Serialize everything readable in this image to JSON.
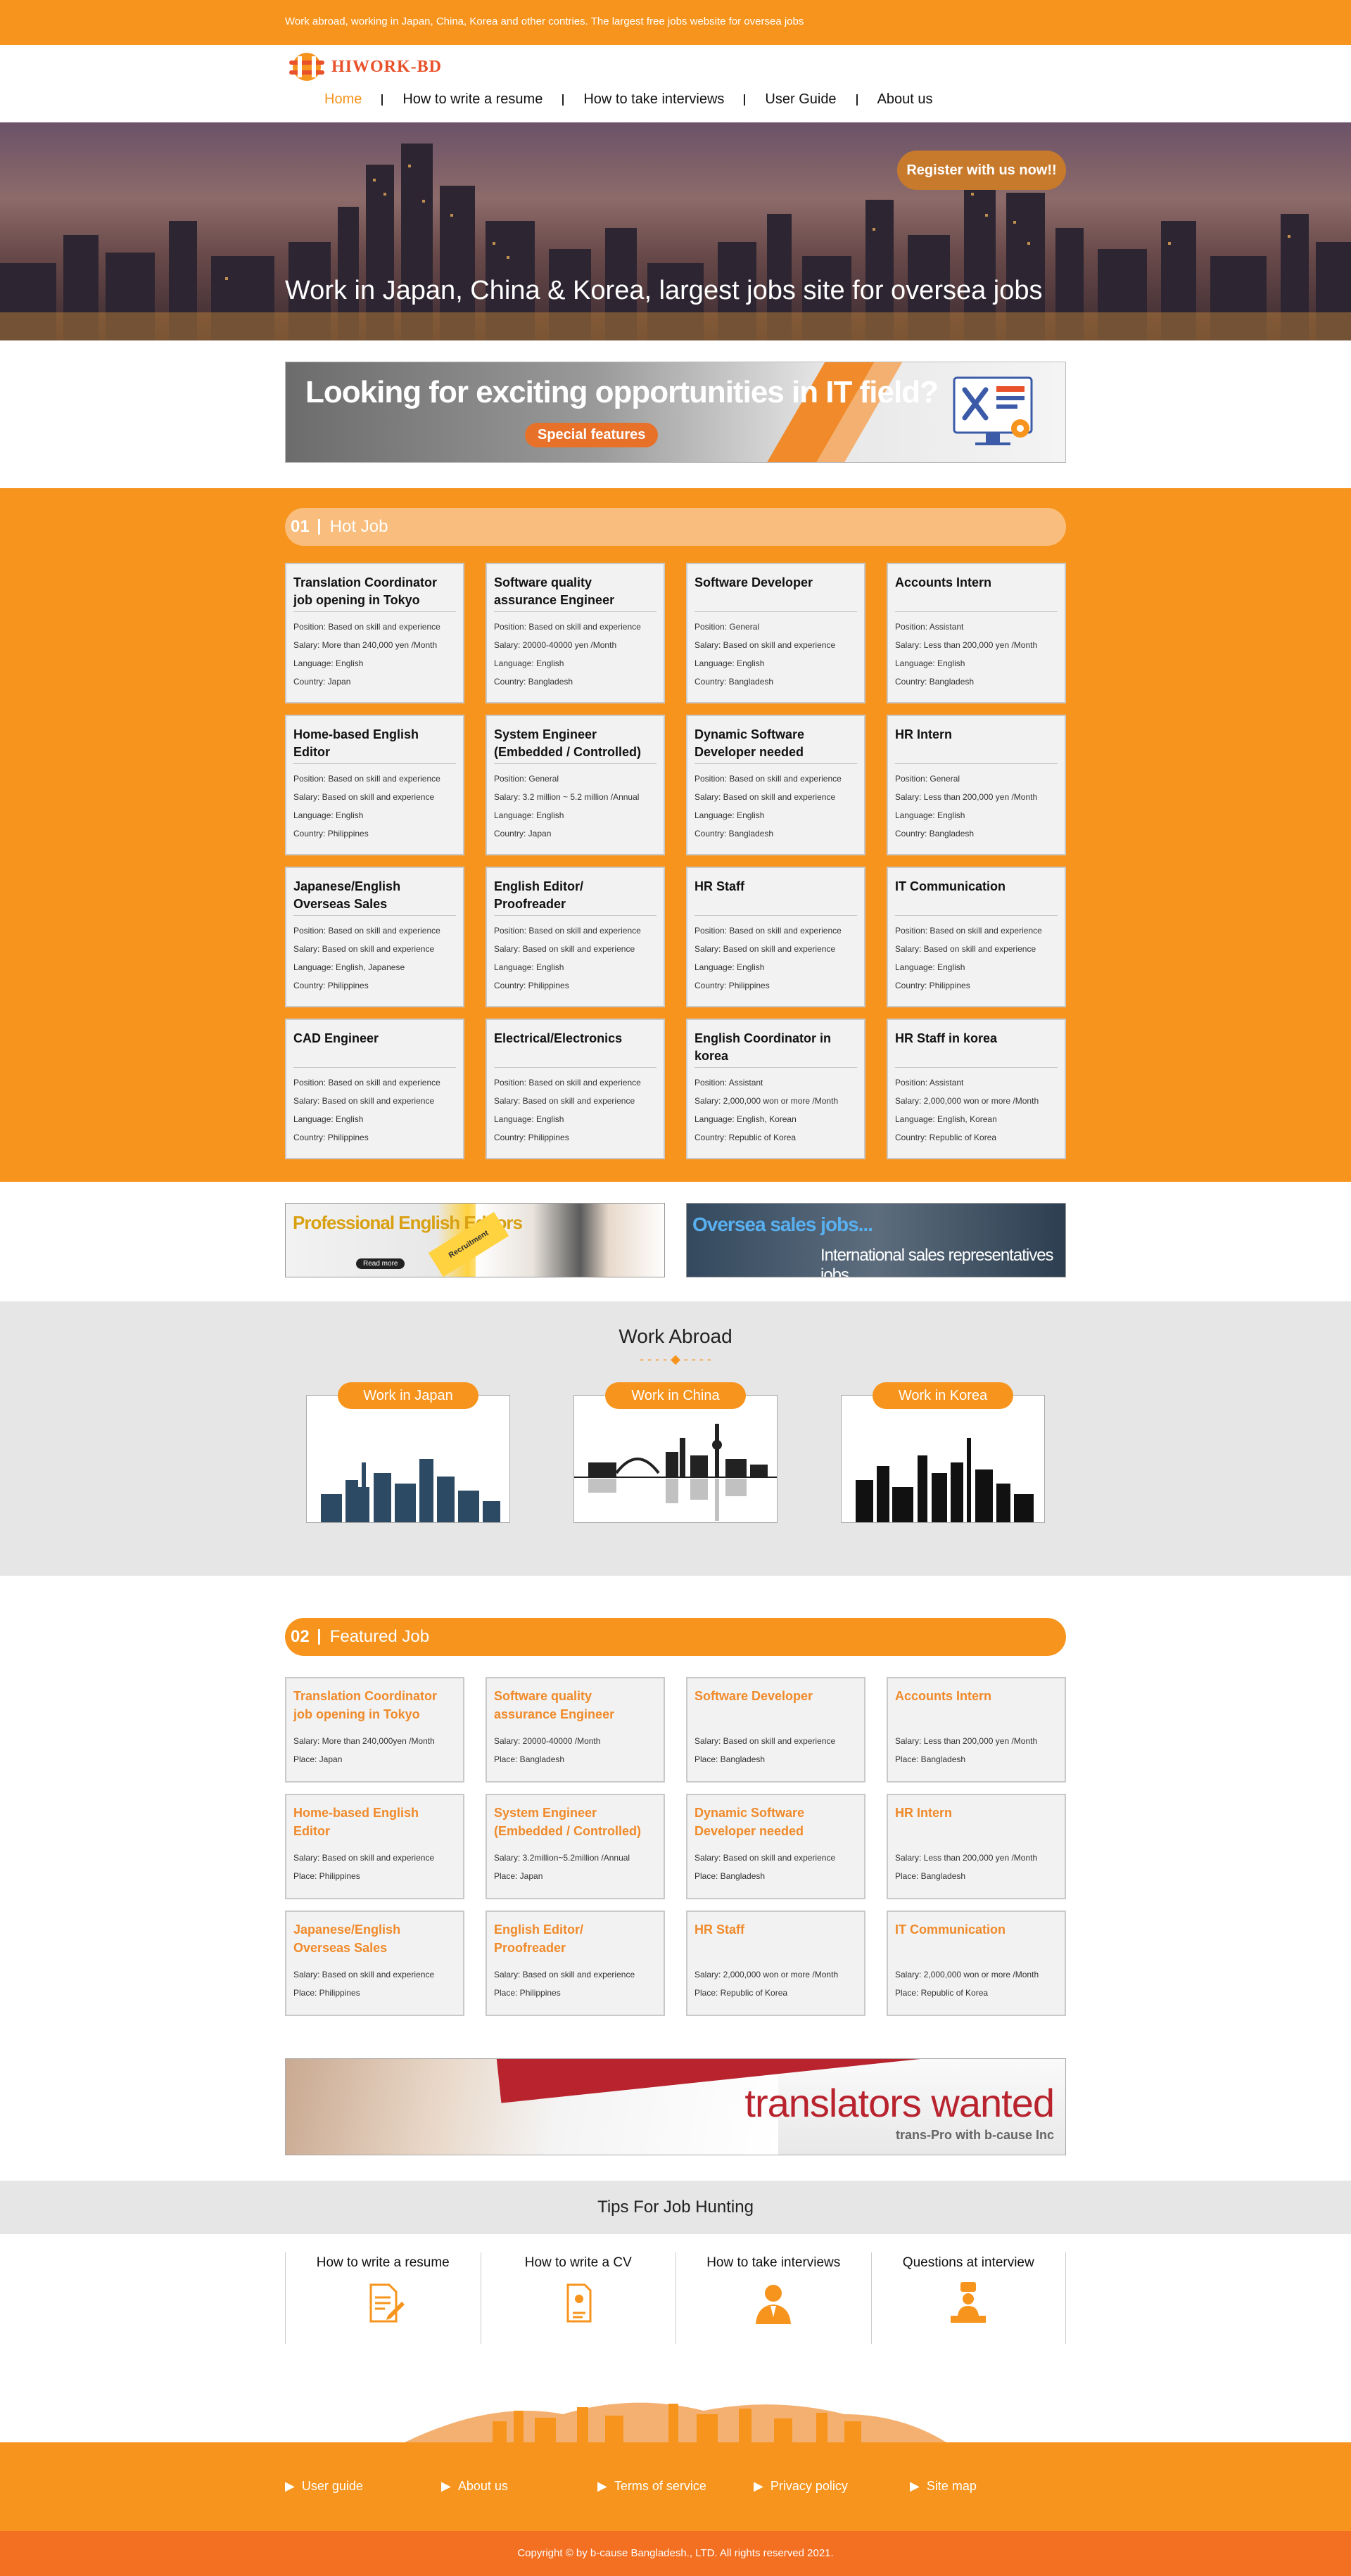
{
  "topbar": {
    "text": "Work abroad, working in Japan, China, Korea and other contries. The largest free jobs website for oversea jobs"
  },
  "logo": {
    "text": "HIWORK-BD"
  },
  "nav": [
    {
      "label": "Home"
    },
    {
      "label": "How to write a resume"
    },
    {
      "label": "How to take interviews"
    },
    {
      "label": "User Guide"
    },
    {
      "label": "About us"
    }
  ],
  "hero": {
    "register": "Register with us now!!",
    "headline": "Work in Japan, China & Korea, largest jobs site for oversea jobs"
  },
  "it_banner": {
    "title": "Looking for exciting opportunities in IT field?",
    "pill": "Special features"
  },
  "hot": {
    "num": "01",
    "title": "Hot Job",
    "jobs": [
      {
        "title": "Translation Coordinator job opening in Tokyo",
        "position": "Position: Based on skill and experience",
        "salary": "Salary: More than 240,000 yen /Month",
        "language": "Language: English",
        "country": "Country: Japan"
      },
      {
        "title": "Software quality assurance Engineer",
        "position": "Position: Based on skill and experience",
        "salary": "Salary: 20000-40000 yen /Month",
        "language": "Language: English",
        "country": "Country: Bangladesh"
      },
      {
        "title": "Software Developer",
        "position": "Position: General",
        "salary": "Salary: Based on skill and experience",
        "language": "Language: English",
        "country": "Country: Bangladesh"
      },
      {
        "title": "Accounts Intern",
        "position": "Position: Assistant",
        "salary": "Salary: Less than 200,000 yen /Month",
        "language": "Language: English",
        "country": "Country: Bangladesh"
      },
      {
        "title": "Home-based English Editor",
        "position": "Position: Based on skill and experience",
        "salary": "Salary: Based on skill and experience",
        "language": "Language: English",
        "country": "Country: Philippines"
      },
      {
        "title": "System Engineer (Embedded / Controlled)",
        "position": "Position: General",
        "salary": "Salary: 3.2 million ~ 5.2 million /Annual",
        "language": "Language: English",
        "country": "Country: Japan"
      },
      {
        "title": "Dynamic Software Developer needed",
        "position": "Position: Based on skill and experience",
        "salary": "Salary: Based on skill and experience",
        "language": "Language: English",
        "country": "Country: Bangladesh"
      },
      {
        "title": "HR Intern",
        "position": "Position: General",
        "salary": "Salary: Less than 200,000 yen /Month",
        "language": "Language: English",
        "country": "Country: Bangladesh"
      },
      {
        "title": "Japanese/English Overseas Sales",
        "position": "Position: Based on skill and experience",
        "salary": "Salary: Based on skill and experience",
        "language": "Language: English, Japanese",
        "country": "Country: Philippines"
      },
      {
        "title": "English Editor/ Proofreader",
        "position": "Position: Based on skill and experience",
        "salary": "Salary: Based on skill and experience",
        "language": "Language: English",
        "country": "Country: Philippines"
      },
      {
        "title": "HR Staff",
        "position": "Position: Based on skill and experience",
        "salary": "Salary: Based on skill and experience",
        "language": "Language: English",
        "country": "Country: Philippines"
      },
      {
        "title": "IT Communication",
        "position": "Position: Based on skill and experience",
        "salary": "Salary: Based on skill and experience",
        "language": "Language: English",
        "country": "Country: Philippines"
      },
      {
        "title": "CAD Engineer",
        "position": "Position: Based on skill and experience",
        "salary": "Salary: Based on skill and experience",
        "language": "Language: English",
        "country": "Country: Philippines"
      },
      {
        "title": "Electrical/Electronics",
        "position": "Position: Based on skill and experience",
        "salary": "Salary: Based on skill and experience",
        "language": "Language: English",
        "country": "Country: Philippines"
      },
      {
        "title": "English Coordinator in korea",
        "position": "Position: Assistant",
        "salary": "Salary: 2,000,000 won or more /Month",
        "language": "Language: English, Korean",
        "country": "Country: Republic of Korea"
      },
      {
        "title": "HR Staff in korea",
        "position": "Position: Assistant",
        "salary": "Salary: 2,000,000 won or more /Month",
        "language": "Language: English, Korean",
        "country": "Country: Republic of Korea"
      }
    ]
  },
  "ads": {
    "ad1_title": "Professional English Editors",
    "ad1_tag": "Recruitment",
    "ad1_more": "Read more",
    "ad2_title": "Oversea sales jobs...",
    "ad2_sub": "International sales representatives jobs..."
  },
  "abroad": {
    "title": "Work Abroad",
    "countries": [
      {
        "label": "Work in Japan"
      },
      {
        "label": "Work in China"
      },
      {
        "label": "Work in Korea"
      }
    ]
  },
  "featured": {
    "num": "02",
    "title": "Featured Job",
    "jobs": [
      {
        "title": "Translation Coordinator job opening in Tokyo",
        "salary": "Salary: More than 240,000yen /Month",
        "place": "Place: Japan"
      },
      {
        "title": "Software quality assurance Engineer",
        "salary": "Salary: 20000-40000 /Month",
        "place": "Place: Bangladesh"
      },
      {
        "title": "Software Developer",
        "salary": "Salary: Based on skill and experience",
        "place": "Place: Bangladesh"
      },
      {
        "title": "Accounts Intern",
        "salary": "Salary: Less than 200,000 yen /Month",
        "place": "Place: Bangladesh"
      },
      {
        "title": "Home-based English Editor",
        "salary": "Salary: Based on skill and experience",
        "place": "Place: Philippines"
      },
      {
        "title": "System Engineer (Embedded / Controlled)",
        "salary": "Salary: 3.2million~5.2million /Annual",
        "place": "Place: Japan"
      },
      {
        "title": "Dynamic Software Developer needed",
        "salary": "Salary: Based on skill and experience",
        "place": "Place: Bangladesh"
      },
      {
        "title": "HR Intern",
        "salary": "Salary: Less than 200,000 yen /Month",
        "place": "Place: Bangladesh"
      },
      {
        "title": "Japanese/English Overseas Sales",
        "salary": "Salary: Based on skill and experience",
        "place": "Place: Philippines"
      },
      {
        "title": "English Editor/ Proofreader",
        "salary": "Salary: Based on skill and experience",
        "place": "Place: Philippines"
      },
      {
        "title": "HR Staff",
        "salary": "Salary: 2,000,000 won or more /Month",
        "place": "Place: Republic of Korea"
      },
      {
        "title": "IT Communication",
        "salary": "Salary: 2,000,000 won or more /Month",
        "place": "Place: Republic of Korea"
      }
    ]
  },
  "translators": {
    "title": "translators wanted",
    "sub": "trans-Pro with b-cause Inc"
  },
  "tips": {
    "title": "Tips For Job Hunting",
    "items": [
      {
        "label": "How to write a resume",
        "icon": "resume-icon"
      },
      {
        "label": "How to write a CV",
        "icon": "cv-icon"
      },
      {
        "label": "How to take interviews",
        "icon": "interview-icon"
      },
      {
        "label": "Questions at interview",
        "icon": "questions-icon"
      }
    ]
  },
  "footer": {
    "links": [
      {
        "label": "User guide"
      },
      {
        "label": "About us"
      },
      {
        "label": "Terms of service"
      },
      {
        "label": "Privacy policy"
      },
      {
        "label": "Site map"
      }
    ],
    "copyright": "Copyright © by b-cause Bangladesh., LTD. All rights reserved 2021."
  },
  "colors": {
    "brand": "#f7941d",
    "brand_light": "#f9be7d",
    "copy_bar": "#f36f21",
    "logo": "#e8512a"
  }
}
